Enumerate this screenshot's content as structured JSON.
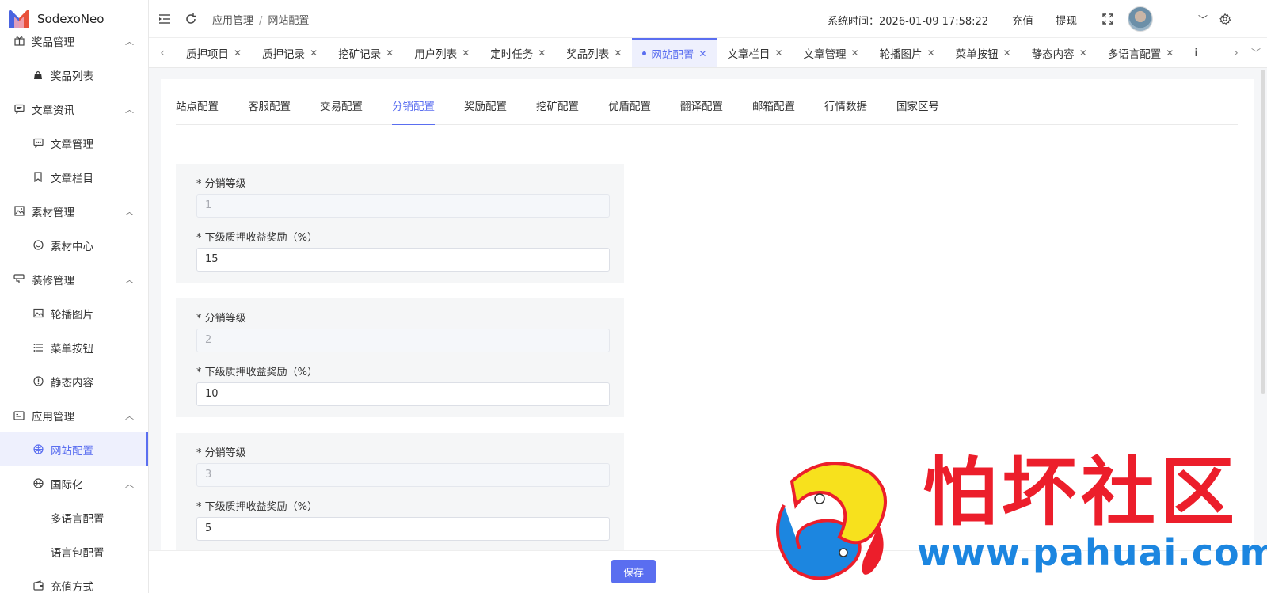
{
  "app": {
    "name": "SodexoNeo"
  },
  "sidebar": {
    "items": [
      {
        "label": "奖品管理",
        "icon": "gift-icon",
        "level": 0,
        "expanded": true
      },
      {
        "label": "奖品列表",
        "icon": "bag-icon",
        "level": 1
      },
      {
        "label": "文章资讯",
        "icon": "message-icon",
        "level": 0,
        "expanded": true
      },
      {
        "label": "文章管理",
        "icon": "chat-dots-icon",
        "level": 1
      },
      {
        "label": "文章栏目",
        "icon": "bookmark-icon",
        "level": 1
      },
      {
        "label": "素材管理",
        "icon": "image-icon",
        "level": 0,
        "expanded": true
      },
      {
        "label": "素材中心",
        "icon": "smile-icon",
        "level": 1
      },
      {
        "label": "装修管理",
        "icon": "brush-icon",
        "level": 0,
        "expanded": true
      },
      {
        "label": "轮播图片",
        "icon": "picture-icon",
        "level": 1
      },
      {
        "label": "菜单按钮",
        "icon": "list-icon",
        "level": 1
      },
      {
        "label": "静态内容",
        "icon": "info-icon",
        "level": 1
      },
      {
        "label": "应用管理",
        "icon": "app-icon",
        "level": 0,
        "expanded": true
      },
      {
        "label": "网站配置",
        "icon": "globe-icon",
        "level": 1,
        "active": true
      },
      {
        "label": "国际化",
        "icon": "basketball-icon",
        "level": 1,
        "expanded": true
      },
      {
        "label": "多语言配置",
        "icon": "",
        "level": 2
      },
      {
        "label": "语言包配置",
        "icon": "",
        "level": 2
      },
      {
        "label": "充值方式",
        "icon": "wallet-icon",
        "level": 1
      }
    ]
  },
  "header": {
    "breadcrumb": [
      "应用管理",
      "网站配置"
    ],
    "sys_time": "系统时间：2026-01-09 17:58:22",
    "recharge": "充值",
    "withdraw": "提现"
  },
  "tabs": [
    {
      "label": "质押项目"
    },
    {
      "label": "质押记录"
    },
    {
      "label": "挖矿记录"
    },
    {
      "label": "用户列表"
    },
    {
      "label": "定时任务"
    },
    {
      "label": "奖品列表"
    },
    {
      "label": "网站配置",
      "active": true
    },
    {
      "label": "文章栏目"
    },
    {
      "label": "文章管理"
    },
    {
      "label": "轮播图片"
    },
    {
      "label": "菜单按钮"
    },
    {
      "label": "静态内容"
    },
    {
      "label": "多语言配置"
    },
    {
      "label": "i"
    }
  ],
  "subtabs": [
    {
      "label": "站点配置"
    },
    {
      "label": "客服配置"
    },
    {
      "label": "交易配置"
    },
    {
      "label": "分销配置",
      "active": true
    },
    {
      "label": "奖励配置"
    },
    {
      "label": "挖矿配置"
    },
    {
      "label": "优盾配置"
    },
    {
      "label": "翻译配置"
    },
    {
      "label": "邮箱配置"
    },
    {
      "label": "行情数据"
    },
    {
      "label": "国家区号"
    }
  ],
  "levels": [
    {
      "level_label": "* 分销等级",
      "level_value": "1",
      "reward_label": "* 下级质押收益奖励（%）",
      "reward_value": "15"
    },
    {
      "level_label": "* 分销等级",
      "level_value": "2",
      "reward_label": "* 下级质押收益奖励（%）",
      "reward_value": "10"
    },
    {
      "level_label": "* 分销等级",
      "level_value": "3",
      "reward_label": "* 下级质押收益奖励（%）",
      "reward_value": "5"
    }
  ],
  "footer": {
    "save_label": "保存"
  },
  "watermark": {
    "text": "怕坏社区",
    "url": "www.pahuai.com"
  },
  "colors": {
    "accent": "#5a6ef0",
    "watermark_red": "#ec1e2b",
    "watermark_blue": "#1c86e0"
  }
}
